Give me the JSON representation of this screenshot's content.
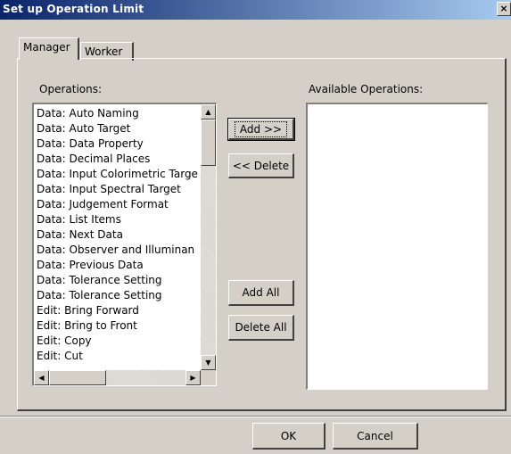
{
  "window": {
    "title": "Set up Operation Limit",
    "close_glyph": "×"
  },
  "tabs": [
    {
      "label": "Manager",
      "active": true
    },
    {
      "label": "Worker",
      "active": false
    }
  ],
  "operations": {
    "label": "Operations:",
    "items": [
      "Data: Auto Naming",
      "Data: Auto Target",
      "Data: Data Property",
      "Data: Decimal Places",
      "Data: Input Colorimetric Targe",
      "Data: Input Spectral Target",
      "Data: Judgement Format",
      "Data: List Items",
      "Data: Next Data",
      "Data: Observer and Illuminan",
      "Data: Previous Data",
      "Data: Tolerance Setting",
      "Data: Tolerance Setting",
      "Edit: Bring Forward",
      "Edit: Bring to Front",
      "Edit: Copy",
      "Edit: Cut"
    ]
  },
  "available": {
    "label": "Available Operations:",
    "items": []
  },
  "buttons": {
    "add": "Add >>",
    "delete": "<< Delete",
    "add_all": "Add All",
    "delete_all": "Delete All",
    "ok": "OK",
    "cancel": "Cancel"
  },
  "icons": {
    "scroll_up": "▲",
    "scroll_down": "▼",
    "scroll_left": "◀",
    "scroll_right": "▶"
  }
}
